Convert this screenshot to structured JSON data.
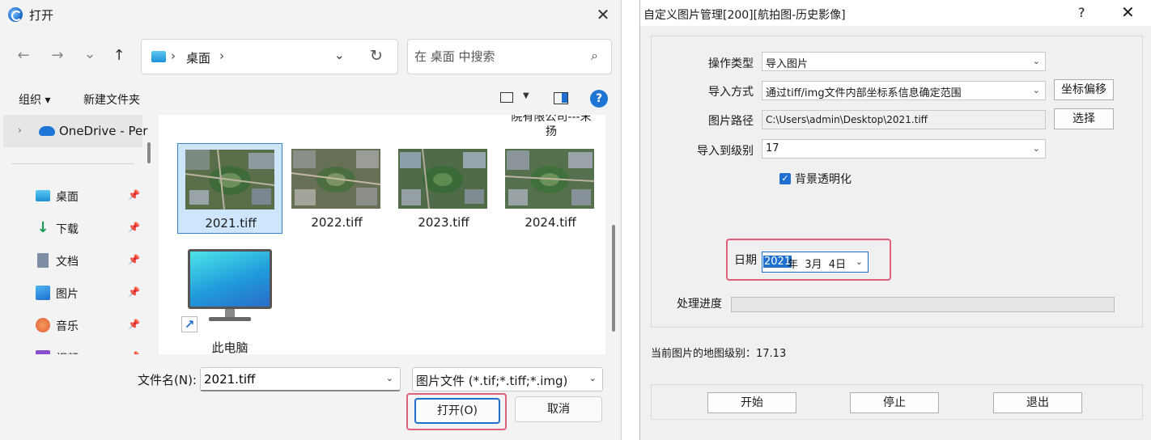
{
  "open_dialog": {
    "title": "打开",
    "nav": {
      "back": "←",
      "forward": "→",
      "recent": "⌄",
      "up": "↑"
    },
    "address": {
      "current": "桌面",
      "separator": "›"
    },
    "search": {
      "placeholder": "在 桌面 中搜索"
    },
    "toolbar": {
      "organize": "组织 ▾",
      "new_folder": "新建文件夹",
      "help": "?"
    },
    "sidebar": {
      "onedrive": "OneDrive - Per",
      "items": [
        {
          "label": "桌面",
          "icon": "desktop-icon"
        },
        {
          "label": "下载",
          "icon": "download-icon"
        },
        {
          "label": "文档",
          "icon": "document-icon"
        },
        {
          "label": "图片",
          "icon": "picture-icon"
        },
        {
          "label": "音乐",
          "icon": "music-icon"
        },
        {
          "label": "视频",
          "icon": "video-icon"
        }
      ]
    },
    "files": {
      "cut_item": "院有限公司---末\n扬",
      "items": [
        {
          "name": "2021.tiff",
          "selected": true
        },
        {
          "name": "2022.tiff",
          "selected": false
        },
        {
          "name": "2023.tiff",
          "selected": false
        },
        {
          "name": "2024.tiff",
          "selected": false
        }
      ],
      "this_pc": "此电脑"
    },
    "filename": {
      "label": "文件名(N):",
      "value": "2021.tiff"
    },
    "filetype": {
      "value": "图片文件 (*.tif;*.tiff;*.img)"
    },
    "buttons": {
      "open": "打开(O)",
      "cancel": "取消"
    }
  },
  "image_dialog": {
    "title": "自定义图片管理[200][航拍图-历史影像]",
    "help": "?",
    "close": "✕",
    "op_type": {
      "label": "操作类型",
      "value": "导入图片"
    },
    "import_mode": {
      "label": "导入方式",
      "value": "通过tiff/img文件内部坐标系信息确定范围",
      "button": "坐标偏移"
    },
    "image_path": {
      "label": "图片路径",
      "value": "C:\\Users\\admin\\Desktop\\2021.tiff",
      "button": "选择"
    },
    "import_level": {
      "label": "导入到级别",
      "value": "17"
    },
    "transparent": {
      "label": "背景透明化",
      "checked": true
    },
    "date": {
      "label": "日期",
      "year": "2021",
      "rest": "年  3月  4日"
    },
    "progress": {
      "label": "处理进度",
      "value": 0
    },
    "current_level": "当前图片的地图级别：17.13",
    "buttons": {
      "start": "开始",
      "stop": "停止",
      "exit": "退出"
    }
  },
  "colors": {
    "accent": "#1f6fd0",
    "highlight_border": "#e0607a",
    "selection_fill": "#cde6fb"
  }
}
